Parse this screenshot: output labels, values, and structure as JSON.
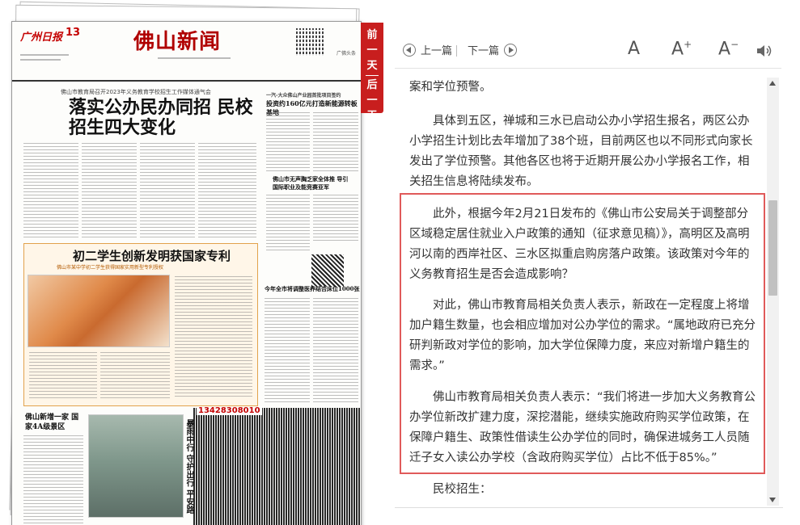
{
  "newspaper": {
    "brand_logo": "广州日报",
    "page_number": "13",
    "masthead_title": "佛山新闻",
    "masthead_right": "广佛头条",
    "lead_kicker": "佛山市教育局召开2023年义务教育学校招生工作媒体通气会",
    "lead_headline": "落实公办民办同招 民校招生四大变化",
    "right_kicker": "一汽-大众佛山产业园首批项目签约",
    "right_headline": "投资约160亿元打造新能源转板基地",
    "right_headline2": "佛山市无声胸乏家全体推 导引国际职业及能竞赛亚军",
    "box_title": "初二学生创新发明获国家专利",
    "box_subtitle": "佛山市某中学初二学生获得国家实用新型专利授权",
    "mid_headline": "今年全市将调整医养结合床位1000张",
    "bottom_headline": "佛山新增一家 国家4A级景区",
    "vertical_headline": "暴雨中行 守护出行 平安路",
    "ad_phone": "13428308010",
    "icon_qr": "qr-code-icon"
  },
  "ribbon": {
    "prev_day": "前一天",
    "next_day": "后一天"
  },
  "toolbar": {
    "prev_article": "上一篇",
    "next_article": "下一篇",
    "font_normal": "A",
    "font_larger": "A",
    "font_larger_sign": "+",
    "font_smaller": "A",
    "font_smaller_sign": "−"
  },
  "article": {
    "p0": "案和学位预警。",
    "p1": "具体到五区，禅城和三水已启动公办小学招生报名，两区公办小学招生计划比去年增加了38个班，目前两区也以不同形式向家长发出了学位预警。其他各区也将于近期开展公办小学报名工作，相关招生信息将陆续发布。",
    "p2": "此外，根据今年2月21日发布的《佛山市公安局关于调整部分区域稳定居住就业入户政策的通知（征求意见稿）》，高明区及高明河以南的西岸社区、三水区拟重启购房落户政策。该政策对今年的义务教育招生是否会造成影响？",
    "p3": "对此，佛山市教育局相关负责人表示，新政在一定程度上将增加户籍生数量，也会相应增加对公办学位的需求。“属地政府已充分研判新政对学位的影响，加大学位保障力度，来应对新增户籍生的需求。”",
    "p4": "佛山市教育局相关负责人表示：“我们将进一步加大义务教育公办学位新改扩建力度，深挖潜能，继续实施政府购买学位政策，在保障户籍生、政策性借读生公办学位的同时，确保进城务工人员随迁子女入读公办学校（含政府购买学位）占比不低于85%。”",
    "p5": "民校招生："
  },
  "colors": {
    "ribbon": "#c81e1e",
    "highlight_border": "#e05a5a",
    "masthead": "#b00000"
  }
}
